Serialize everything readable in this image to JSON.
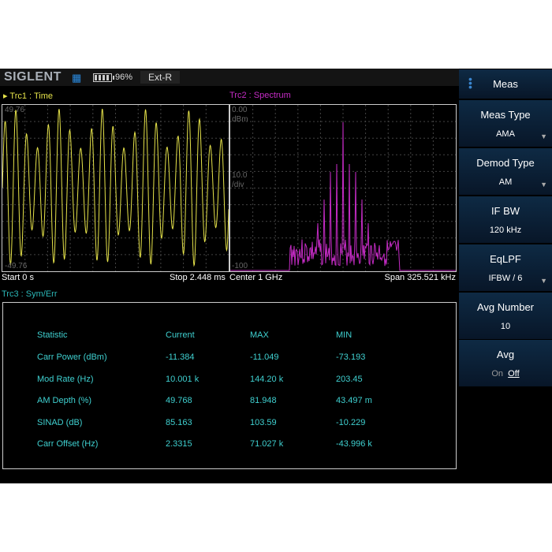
{
  "header": {
    "logo": "SIGLENT",
    "battery": "96%",
    "ref": "Ext-R"
  },
  "trc1": {
    "label": "Trc1 :  Time",
    "top": "49.76",
    "bottom": "-49.76"
  },
  "trc2": {
    "label": "Trc2 :  Spectrum",
    "ref_level": "0.00",
    "ref_unit": "dBm",
    "scale": "10.0",
    "scale_unit": "/div",
    "bottom": "-100"
  },
  "status": {
    "start": "Start 0 s",
    "stop": "Stop 2.448 ms",
    "center": "Center 1 GHz",
    "span": "Span 325.521 kHz"
  },
  "trc3": {
    "label": "Trc3 :  Sym/Err"
  },
  "table": {
    "headers": [
      "Statistic",
      "Current",
      "MAX",
      "MIN"
    ],
    "rows": [
      [
        "Carr Power (dBm)",
        "-11.384",
        "-11.049",
        "-73.193"
      ],
      [
        "Mod Rate (Hz)",
        "10.001 k",
        "144.20 k",
        "203.45"
      ],
      [
        "AM Depth (%)",
        "49.768",
        "81.948",
        "43.497 m"
      ],
      [
        "SINAD (dB)",
        "85.163",
        "103.59",
        "-10.229"
      ],
      [
        "Carr Offset (Hz)",
        "2.3315",
        "71.027 k",
        "-43.996 k"
      ]
    ]
  },
  "menu": {
    "title": "Meas",
    "items": [
      {
        "label": "Meas Type",
        "value": "AMA",
        "dropdown": true
      },
      {
        "label": "Demod Type",
        "value": "AM",
        "dropdown": true
      },
      {
        "label": "IF BW",
        "value": "120 kHz"
      },
      {
        "label": "EqLPF",
        "value": "IFBW / 6",
        "dropdown": true
      },
      {
        "label": "Avg Number",
        "value": "10"
      }
    ],
    "avg": {
      "label": "Avg",
      "on": "On",
      "off": "Off"
    }
  },
  "colors": {
    "trace1": "#e6e34a",
    "trace2": "#c42bc4",
    "trace3": "#3fd0d0"
  }
}
